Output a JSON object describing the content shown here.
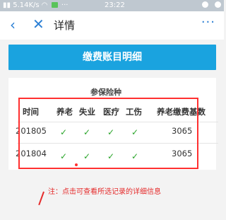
{
  "status_bar": {
    "left_text": "5.14K/s",
    "time": "23:22"
  },
  "nav": {
    "title": "详情",
    "back_icon": "‹",
    "close_icon": "✕",
    "more_icon": "···"
  },
  "header": {
    "title": "缴费账目明细"
  },
  "table": {
    "group_title": "参保险种",
    "columns": [
      "时间",
      "养老",
      "失业",
      "医疗",
      "工伤",
      "养老缴费基数"
    ],
    "rows": [
      {
        "time": "201805",
        "yanglao": "✓",
        "shiye": "✓",
        "yiliao": "✓",
        "gongshang": "✓",
        "base": "3065"
      },
      {
        "time": "201804",
        "yanglao": "✓",
        "shiye": "✓",
        "yiliao": "✓",
        "gongshang": "✓",
        "base": "3065"
      }
    ]
  },
  "note": "注：点击可查看所选记录的详细信息",
  "colors": {
    "brand_blue": "#1aa3df",
    "check_green": "#2aa52a",
    "highlight_red": "#ff3030"
  }
}
